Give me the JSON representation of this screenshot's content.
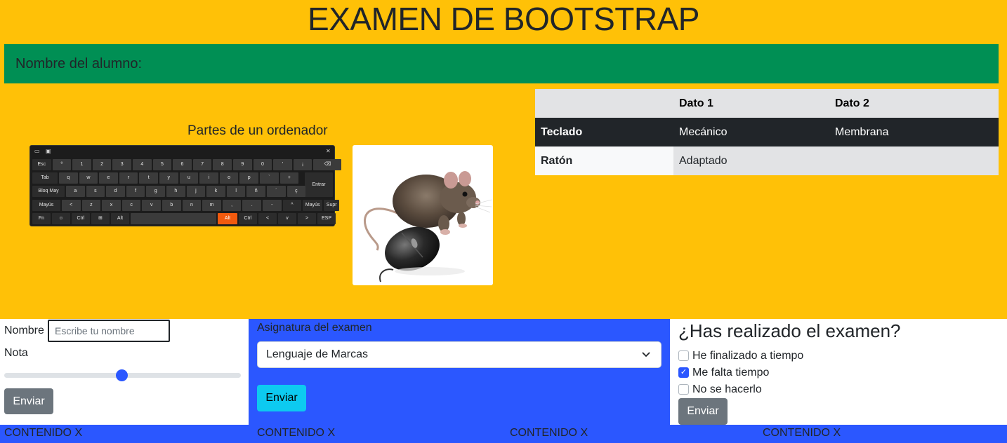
{
  "header": {
    "title": "EXAMEN DE BOOTSTRAP",
    "student_label": "Nombre del alumno:"
  },
  "hardware": {
    "subtitle": "Partes de un ordenador",
    "keyboard_image": "onscreen-keyboard-image",
    "mouse_image": "rat-with-mouse-image"
  },
  "keyboard": {
    "row0": [
      "Esc",
      "º",
      "1",
      "2",
      "3",
      "4",
      "5",
      "6",
      "7",
      "8",
      "9",
      "0",
      "'",
      "¡",
      "⌫"
    ],
    "row1": [
      "Tab",
      "q",
      "w",
      "e",
      "r",
      "t",
      "y",
      "u",
      "i",
      "o",
      "p",
      "`",
      "+"
    ],
    "row2": [
      "Bloq May",
      "a",
      "s",
      "d",
      "f",
      "g",
      "h",
      "j",
      "k",
      "l",
      "ñ",
      "´",
      "ç"
    ],
    "row3": [
      "Mayús",
      "<",
      "z",
      "x",
      "c",
      "v",
      "b",
      "n",
      "m",
      ",",
      ".",
      "-",
      "^",
      "Mayús",
      "Supr"
    ],
    "row4": [
      "Fn",
      "☺",
      "Ctrl",
      "⊞",
      "Alt",
      "",
      "Alt",
      "Ctrl",
      "<",
      "v",
      ">",
      "ESP"
    ],
    "enter": "Entrar"
  },
  "table": {
    "headers": [
      "",
      "Dato 1",
      "Dato 2"
    ],
    "rows": [
      {
        "label": "Teclado",
        "d1": "Mecánico",
        "d2": "Membrana"
      },
      {
        "label": "Ratón",
        "d1": "Adaptado",
        "d2": ""
      }
    ]
  },
  "form1": {
    "name_label": "Nombre",
    "name_placeholder": "Escribe tu nombre",
    "grade_label": "Nota",
    "grade_value": 0.5,
    "submit": "Enviar"
  },
  "form2": {
    "subject_label": "Asignatura del examen",
    "subject_selected": "Lenguaje de Marcas",
    "submit": "Enviar"
  },
  "form3": {
    "question": "¿Has realizado el examen?",
    "options": [
      {
        "label": "He finalizado a tiempo",
        "checked": false
      },
      {
        "label": "Me falta tiempo",
        "checked": true
      },
      {
        "label": "No se hacerlo",
        "checked": false
      }
    ],
    "submit": "Enviar"
  },
  "footer": {
    "items": [
      "CONTENIDO X",
      "CONTENIDO X",
      "CONTENIDO X",
      "CONTENIDO X"
    ]
  },
  "colors": {
    "top_bg": "#ffc107",
    "student_bar": "#008f54",
    "blue": "#2b57ff",
    "cyan_button": "#0dcaf0",
    "grey_button": "#6c757d"
  }
}
